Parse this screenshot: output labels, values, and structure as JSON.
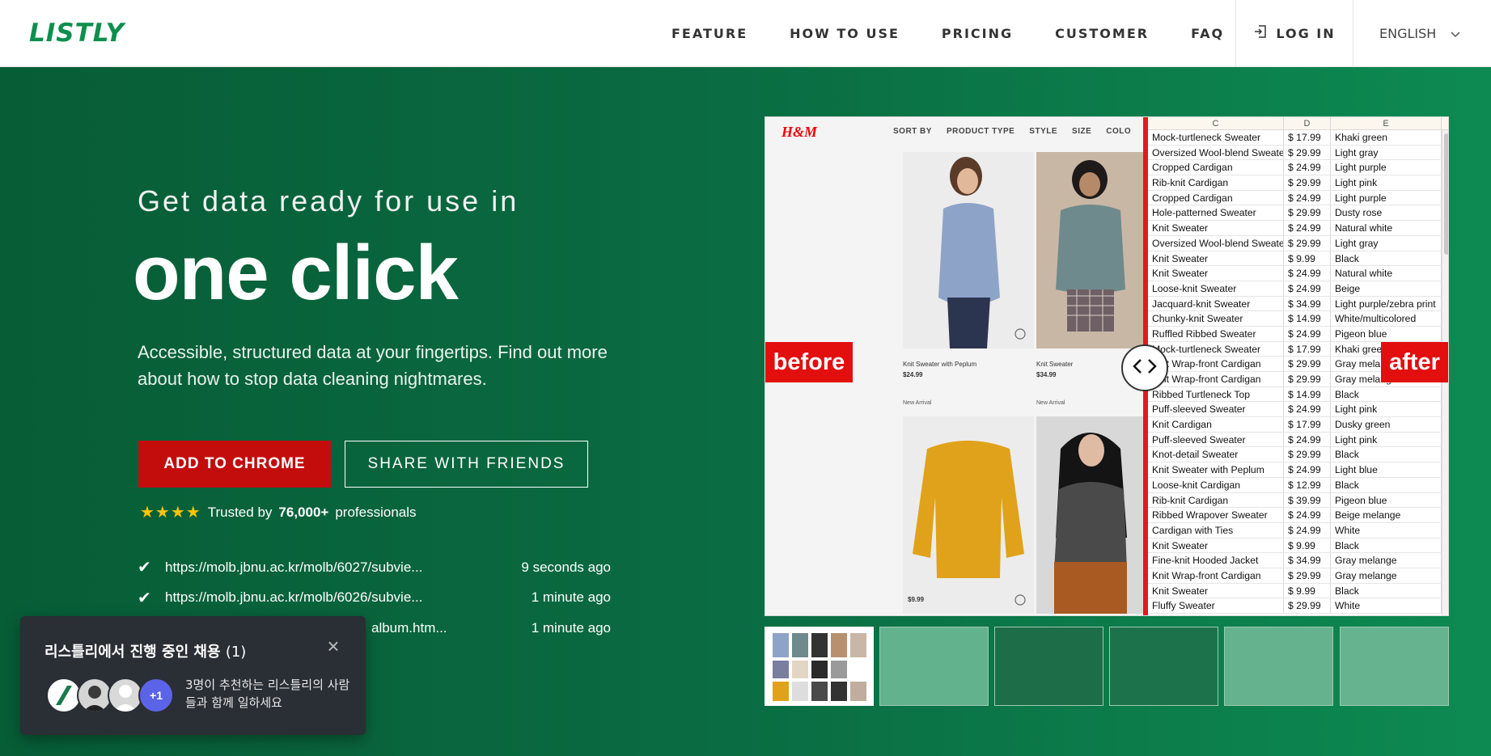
{
  "nav": {
    "logo": "LISTLY",
    "links": [
      "FEATURE",
      "HOW TO USE",
      "PRICING",
      "CUSTOMER",
      "FAQ"
    ],
    "login": "LOG IN",
    "language": "ENGLISH"
  },
  "hero": {
    "subtitle": "Get data ready for use in",
    "headline": "one click",
    "description": "Accessible, structured data at your fingertips. Find out more about how to stop data cleaning nightmares.",
    "add_button": "ADD TO CHROME",
    "share_button": "SHARE WITH FRIENDS",
    "trusted_prefix": "Trusted by",
    "trusted_count": "76,000+",
    "trusted_suffix": "professionals",
    "stars": "★★★★"
  },
  "recent": [
    {
      "url": "https://molb.jbnu.ac.kr/molb/6027/subvie...",
      "time": "9 seconds ago"
    },
    {
      "url": "https://molb.jbnu.ac.kr/molb/6026/subvie...",
      "time": "1 minute ago"
    },
    {
      "url": "album.htm...",
      "time": "1 minute ago"
    }
  ],
  "showcase": {
    "before_label": "before",
    "after_label": "after",
    "shop": {
      "logo": "H&M",
      "menu": [
        "SORT BY",
        "PRODUCT TYPE",
        "STYLE",
        "SIZE",
        "COLO"
      ],
      "products": [
        {
          "name": "Knit Sweater with Peplum",
          "price": "$24.99",
          "tag": "New Arrival",
          "color": "#8ea3c8"
        },
        {
          "name": "Knit Sweater",
          "price": "$34.99",
          "tag": "New Arrival",
          "color": "#6f8a8c"
        },
        {
          "name": "",
          "price": "$9.99",
          "tag": "",
          "color": "#e0a21a"
        },
        {
          "name": "",
          "price": "",
          "tag": "",
          "color": "#4a4a4a"
        }
      ]
    },
    "sheet": {
      "columns": [
        "C",
        "D",
        "E"
      ],
      "rows": [
        [
          "Mock-turtleneck Sweater",
          "$ 17.99",
          "Khaki green"
        ],
        [
          "Oversized Wool-blend Sweater",
          "$ 29.99",
          "Light gray"
        ],
        [
          "Cropped Cardigan",
          "$ 24.99",
          "Light purple"
        ],
        [
          "Rib-knit Cardigan",
          "$ 29.99",
          "Light pink"
        ],
        [
          "Cropped Cardigan",
          "$ 24.99",
          "Light purple"
        ],
        [
          "Hole-patterned Sweater",
          "$ 29.99",
          "Dusty rose"
        ],
        [
          "Knit Sweater",
          "$ 24.99",
          "Natural white"
        ],
        [
          "Oversized Wool-blend Sweater",
          "$ 29.99",
          "Light gray"
        ],
        [
          "Knit Sweater",
          "$ 9.99",
          "Black"
        ],
        [
          "Knit Sweater",
          "$ 24.99",
          "Natural white"
        ],
        [
          "Loose-knit Sweater",
          "$ 24.99",
          "Beige"
        ],
        [
          "Jacquard-knit Sweater",
          "$ 34.99",
          "Light purple/zebra print"
        ],
        [
          "Chunky-knit Sweater",
          "$ 14.99",
          "White/multicolored"
        ],
        [
          "Ruffled Ribbed Sweater",
          "$ 24.99",
          "Pigeon blue"
        ],
        [
          "Mock-turtleneck Sweater",
          "$ 17.99",
          "Khaki green"
        ],
        [
          "Knit Wrap-front Cardigan",
          "$ 29.99",
          "Gray melange"
        ],
        [
          "Knit Wrap-front Cardigan",
          "$ 29.99",
          "Gray melange"
        ],
        [
          "Ribbed Turtleneck Top",
          "$ 14.99",
          "Black"
        ],
        [
          "Puff-sleeved Sweater",
          "$ 24.99",
          "Light pink"
        ],
        [
          "Knit Cardigan",
          "$ 17.99",
          "Dusky green"
        ],
        [
          "Puff-sleeved Sweater",
          "$ 24.99",
          "Light pink"
        ],
        [
          "Knot-detail Sweater",
          "$ 29.99",
          "Black"
        ],
        [
          "Knit Sweater with Peplum",
          "$ 24.99",
          "Light blue"
        ],
        [
          "Loose-knit Cardigan",
          "$ 12.99",
          "Black"
        ],
        [
          "Rib-knit Cardigan",
          "$ 39.99",
          "Pigeon blue"
        ],
        [
          "Ribbed Wrapover Sweater",
          "$ 24.99",
          "Beige melange"
        ],
        [
          "Cardigan with Ties",
          "$ 24.99",
          "White"
        ],
        [
          "Knit Sweater",
          "$ 9.99",
          "Black"
        ],
        [
          "Fine-knit Hooded Jacket",
          "$ 34.99",
          "Gray melange"
        ],
        [
          "Knit Wrap-front Cardigan",
          "$ 29.99",
          "Gray melange"
        ],
        [
          "Knit Sweater",
          "$ 9.99",
          "Black"
        ],
        [
          "Fluffy Sweater",
          "$ 29.99",
          "White"
        ]
      ]
    },
    "thumbnails": 6
  },
  "popup": {
    "title": "리스틀리에서 진행 중인 채용",
    "count": "(1)",
    "more": "+1",
    "text": "3명이 추천하는 리스틀리의 사람들과 함께 일하세요"
  },
  "colors": {
    "brand_green": "#0d8f4d",
    "accent_red": "#c30d0d",
    "star": "#f8c40a"
  }
}
